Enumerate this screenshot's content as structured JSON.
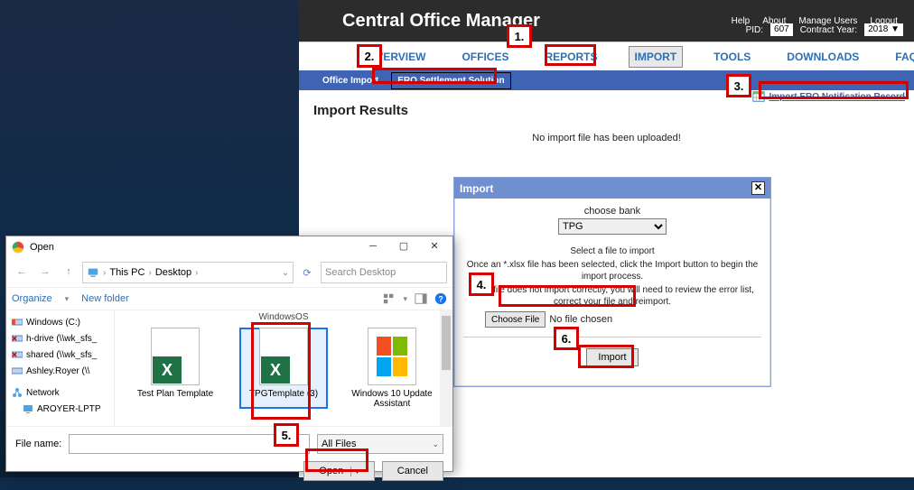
{
  "header": {
    "title": "Central Office Manager",
    "links": [
      "Help",
      "About",
      "Manage Users",
      "Logout"
    ],
    "pid_label": "PID:",
    "pid_value": "607",
    "year_label": "Contract Year:",
    "year_value": "2018 ▼"
  },
  "nav": {
    "items": [
      "OVERVIEW",
      "OFFICES",
      "REPORTS",
      "IMPORT",
      "TOOLS",
      "DOWNLOADS",
      "FAQ"
    ],
    "active": "IMPORT"
  },
  "subnav": {
    "items": [
      "Office Import",
      "ERO Settlement Solution"
    ],
    "active": "ERO Settlement Solution"
  },
  "content": {
    "heading": "Import Results",
    "no_import": "No import file has been uploaded!",
    "link_text": "Import ERO Notification Record"
  },
  "import_dialog": {
    "title": "Import",
    "choose_bank_label": "choose bank",
    "bank_value": "TPG",
    "select_label": "Select a file to import",
    "help1": "Once an *.xlsx file has been selected, click the Import button to begin the import process.",
    "help2": "If the file does not import correctly, you will need to review the error list, correct your file and reimport.",
    "choose_file_btn": "Choose File",
    "no_file": "No file chosen",
    "import_btn": "Import"
  },
  "file_dialog": {
    "title": "Open",
    "path": {
      "root": "This PC",
      "folder": "Desktop"
    },
    "search_placeholder": "Search Desktop",
    "toolbar": {
      "organize": "Organize",
      "new_folder": "New folder"
    },
    "tree": [
      {
        "icon": "win",
        "label": "Windows (C:)"
      },
      {
        "icon": "netx",
        "label": "h-drive (\\\\wk_sfs_"
      },
      {
        "icon": "netx",
        "label": "shared (\\\\wk_sfs_"
      },
      {
        "icon": "net",
        "label": "Ashley.Royer (\\\\"
      },
      {
        "icon": "net-root",
        "label": "Network"
      },
      {
        "icon": "pc",
        "label": "AROYER-LPTP"
      }
    ],
    "group_label": "WindowsOS",
    "items": [
      {
        "name": "Test Plan Template",
        "type": "xlsx",
        "selected": false
      },
      {
        "name": "TPGTemplate (3)",
        "type": "xlsx",
        "selected": true
      },
      {
        "name": "Windows 10 Update Assistant",
        "type": "win",
        "selected": false
      }
    ],
    "filename_label": "File name:",
    "filename_value": "",
    "filter": "All Files",
    "open_btn": "Open",
    "cancel_btn": "Cancel"
  },
  "callouts": {
    "c1": "1.",
    "c2": "2.",
    "c3": "3.",
    "c4": "4.",
    "c5": "5.",
    "c6": "6."
  }
}
